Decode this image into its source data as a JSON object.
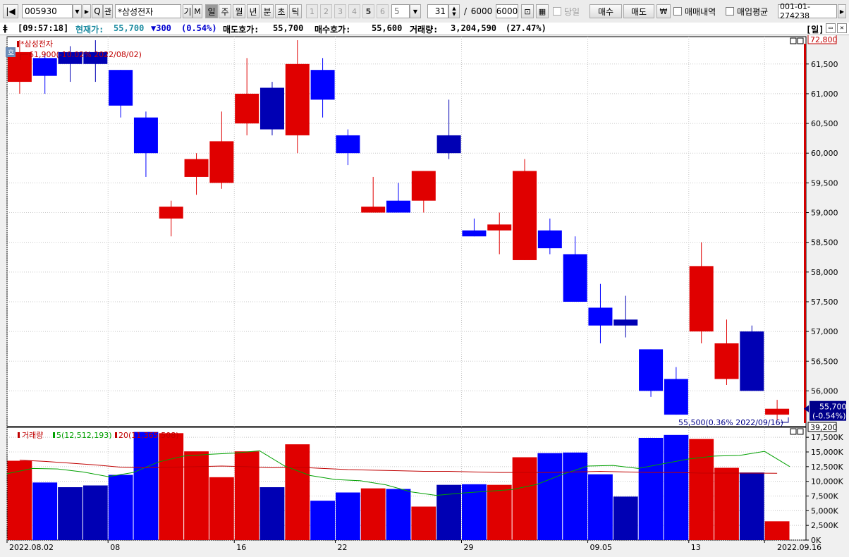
{
  "toolbar": {
    "code": "005930",
    "search_label": "Q",
    "btn_chart": "관",
    "name": "*삼성전자",
    "btn_gi": "기",
    "btn_m": "M",
    "periods": [
      "일",
      "주",
      "월",
      "년",
      "분",
      "초",
      "틱"
    ],
    "active_period": "일",
    "num_buttons": [
      "1",
      "2",
      "3",
      "4",
      "5",
      "6"
    ],
    "interval_value": "5",
    "count_value": "31",
    "count_sep": "/",
    "count_total": "6000",
    "count_input": "6000",
    "today_label": "당일",
    "buy_label": "매수",
    "sell_label": "매도",
    "won_symbol": "₩",
    "trade_history_label": "매매내역",
    "avg_price_label": "매입평균",
    "account": "001-01-274238"
  },
  "infobar": {
    "time": "[09:57:18]",
    "price_label": "현재가:",
    "price_value": "55,700",
    "change": "▼300",
    "change_pct": "(0.54%)",
    "ask_label": "매도호가:",
    "ask_value": "55,700",
    "bid_label": "매수호가:",
    "bid_value": "55,600",
    "volume_label": "거래량:",
    "volume_value": "3,204,590",
    "volume_pct": "(27.47%)",
    "period_tag": "[일]"
  },
  "colors": {
    "up": "#e00000",
    "down_light": "#0000ff",
    "down_dark": "#0000b4",
    "ma5": "#00a000",
    "ma20": "#c00000"
  },
  "chart_data": [
    {
      "type": "candlestick",
      "title": "*삼성전자",
      "ylim": [
        55400,
        61960
      ],
      "y_ticks": [
        "61,500",
        "61,000",
        "60,500",
        "60,000",
        "59,500",
        "59,000",
        "58,500",
        "58,000",
        "57,500",
        "57,000",
        "56,500",
        "56,000"
      ],
      "y_tick_values": [
        61500,
        61000,
        60500,
        60000,
        59500,
        59000,
        58500,
        58000,
        57500,
        57000,
        56500,
        56000
      ],
      "max_annotation": "61,900(-10.02% 2022/08/02)",
      "min_annotation": "55,500(0.36% 2022/09/16)",
      "current_price_label": "55,700",
      "current_change_label": "(-0.54%)",
      "axis_top_label": "72,800",
      "axis_bottom_label": "39,200",
      "badge": "호",
      "current_price": 55700,
      "candles": [
        {
          "date": "2022-08-02",
          "open": 61200,
          "high": 61900,
          "low": 61000,
          "close": 61700,
          "color": "up"
        },
        {
          "date": "2022-08-03",
          "open": 61600,
          "high": 61700,
          "low": 61000,
          "close": 61300,
          "color": "down_light"
        },
        {
          "date": "2022-08-04",
          "open": 61500,
          "high": 61800,
          "low": 61200,
          "close": 61700,
          "color": "down_dark"
        },
        {
          "date": "2022-08-05",
          "open": 61500,
          "high": 61900,
          "low": 61200,
          "close": 61700,
          "color": "down_dark"
        },
        {
          "date": "2022-08-08",
          "open": 61400,
          "high": 61400,
          "low": 60600,
          "close": 60800,
          "color": "down_light"
        },
        {
          "date": "2022-08-09",
          "open": 60600,
          "high": 60700,
          "low": 59600,
          "close": 60000,
          "color": "down_light"
        },
        {
          "date": "2022-08-10",
          "open": 59100,
          "high": 59200,
          "low": 58600,
          "close": 58900,
          "color": "up"
        },
        {
          "date": "2022-08-11",
          "open": 59600,
          "high": 60000,
          "low": 59300,
          "close": 59900,
          "color": "up"
        },
        {
          "date": "2022-08-12",
          "open": 59500,
          "high": 60700,
          "low": 59400,
          "close": 60200,
          "color": "up"
        },
        {
          "date": "2022-08-16",
          "open": 60500,
          "high": 61600,
          "low": 60300,
          "close": 61000,
          "color": "up"
        },
        {
          "date": "2022-08-17",
          "open": 61100,
          "high": 61200,
          "low": 60300,
          "close": 60400,
          "color": "down_dark"
        },
        {
          "date": "2022-08-18",
          "open": 60300,
          "high": 61900,
          "low": 60000,
          "close": 61500,
          "color": "up"
        },
        {
          "date": "2022-08-19",
          "open": 61400,
          "high": 61600,
          "low": 60600,
          "close": 60900,
          "color": "down_light"
        },
        {
          "date": "2022-08-22",
          "open": 60300,
          "high": 60400,
          "low": 59800,
          "close": 60000,
          "color": "down_light"
        },
        {
          "date": "2022-08-23",
          "open": 59000,
          "high": 59600,
          "low": 59000,
          "close": 59100,
          "color": "up"
        },
        {
          "date": "2022-08-24",
          "open": 59200,
          "high": 59500,
          "low": 59000,
          "close": 59000,
          "color": "down_light"
        },
        {
          "date": "2022-08-25",
          "open": 59200,
          "high": 59700,
          "low": 59000,
          "close": 59700,
          "color": "up"
        },
        {
          "date": "2022-08-26",
          "open": 60300,
          "high": 60900,
          "low": 59900,
          "close": 60000,
          "color": "down_dark"
        },
        {
          "date": "2022-08-29",
          "open": 58700,
          "high": 58900,
          "low": 58600,
          "close": 58600,
          "color": "down_light"
        },
        {
          "date": "2022-08-30",
          "open": 58700,
          "high": 59000,
          "low": 58300,
          "close": 58800,
          "color": "up"
        },
        {
          "date": "2022-08-31",
          "open": 58200,
          "high": 59900,
          "low": 58200,
          "close": 59700,
          "color": "up"
        },
        {
          "date": "2022-09-01",
          "open": 58700,
          "high": 58900,
          "low": 58300,
          "close": 58400,
          "color": "down_light"
        },
        {
          "date": "2022-09-02",
          "open": 58300,
          "high": 58600,
          "low": 57500,
          "close": 57500,
          "color": "down_light"
        },
        {
          "date": "2022-09-05",
          "open": 57400,
          "high": 57800,
          "low": 56800,
          "close": 57100,
          "color": "down_light"
        },
        {
          "date": "2022-09-06",
          "open": 57200,
          "high": 57600,
          "low": 56900,
          "close": 57100,
          "color": "down_dark"
        },
        {
          "date": "2022-09-07",
          "open": 56700,
          "high": 56700,
          "low": 55900,
          "close": 56000,
          "color": "down_light"
        },
        {
          "date": "2022-09-08",
          "open": 56200,
          "high": 56400,
          "low": 55600,
          "close": 55600,
          "color": "down_light"
        },
        {
          "date": "2022-09-13",
          "open": 57000,
          "high": 58500,
          "low": 56800,
          "close": 58100,
          "color": "up"
        },
        {
          "date": "2022-09-14",
          "open": 56200,
          "high": 57200,
          "low": 56100,
          "close": 56800,
          "color": "up"
        },
        {
          "date": "2022-09-15",
          "open": 57000,
          "high": 57100,
          "low": 56000,
          "close": 56000,
          "color": "down_dark"
        },
        {
          "date": "2022-09-16",
          "open": 55600,
          "high": 55850,
          "low": 55500,
          "close": 55700,
          "color": "up"
        }
      ]
    },
    {
      "type": "bar",
      "title": "거래량",
      "legend": [
        {
          "name": "거래량",
          "color": "up"
        },
        {
          "name": "5(12,512,193)",
          "color": "ma5"
        },
        {
          "name": "20(11,365,508)",
          "color": "ma20"
        }
      ],
      "ylim": [
        0,
        19200000
      ],
      "y_ticks": [
        "17,500K",
        "15,000K",
        "12,500K",
        "10,000K",
        "7,500K",
        "5,000K",
        "2,500K",
        "0K"
      ],
      "y_tick_values": [
        17500000,
        15000000,
        12500000,
        10000000,
        7500000,
        5000000,
        2500000,
        0
      ],
      "volumes": [
        13500000,
        9800000,
        9000000,
        9300000,
        11100000,
        18400000,
        18200000,
        15100000,
        10700000,
        15100000,
        9000000,
        16300000,
        6700000,
        8100000,
        8800000,
        8700000,
        5700000,
        9400000,
        9500000,
        9400000,
        14100000,
        14800000,
        14900000,
        11200000,
        7400000,
        17400000,
        17900000,
        17200000,
        12300000,
        11500000,
        3200000
      ],
      "ma5": [
        11300000,
        12200000,
        12100000,
        11600000,
        10800000,
        11500000,
        13300000,
        14300000,
        14600000,
        14800000,
        15200000,
        12600000,
        11000000,
        10300000,
        10100000,
        9400000,
        8200000,
        7600000,
        8000000,
        8300000,
        8600000,
        9500000,
        11200000,
        12600000,
        12700000,
        12200000,
        13000000,
        13800000,
        14300000,
        14400000,
        15100000,
        12500000
      ],
      "ma20": [
        13600000,
        13400000,
        13100000,
        12800000,
        12400000,
        12300000,
        12400000,
        12500000,
        12600000,
        12500000,
        12300000,
        12400000,
        12200000,
        12000000,
        11900000,
        11800000,
        11700000,
        11700000,
        11600000,
        11500000,
        11500000,
        11500000,
        11600000,
        11700000,
        11600000,
        11500000,
        11500000,
        11400000,
        11400000,
        11400000,
        11365508
      ],
      "x_tick_labels": [
        {
          "label": "2022.08.02",
          "index": 0
        },
        {
          "label": "08",
          "index": 4
        },
        {
          "label": "16",
          "index": 9
        },
        {
          "label": "22",
          "index": 13
        },
        {
          "label": "29",
          "index": 18
        },
        {
          "label": "09.05",
          "index": 23
        },
        {
          "label": "13",
          "index": 27
        },
        {
          "label": "2022.09.16",
          "index": 30
        }
      ]
    }
  ]
}
